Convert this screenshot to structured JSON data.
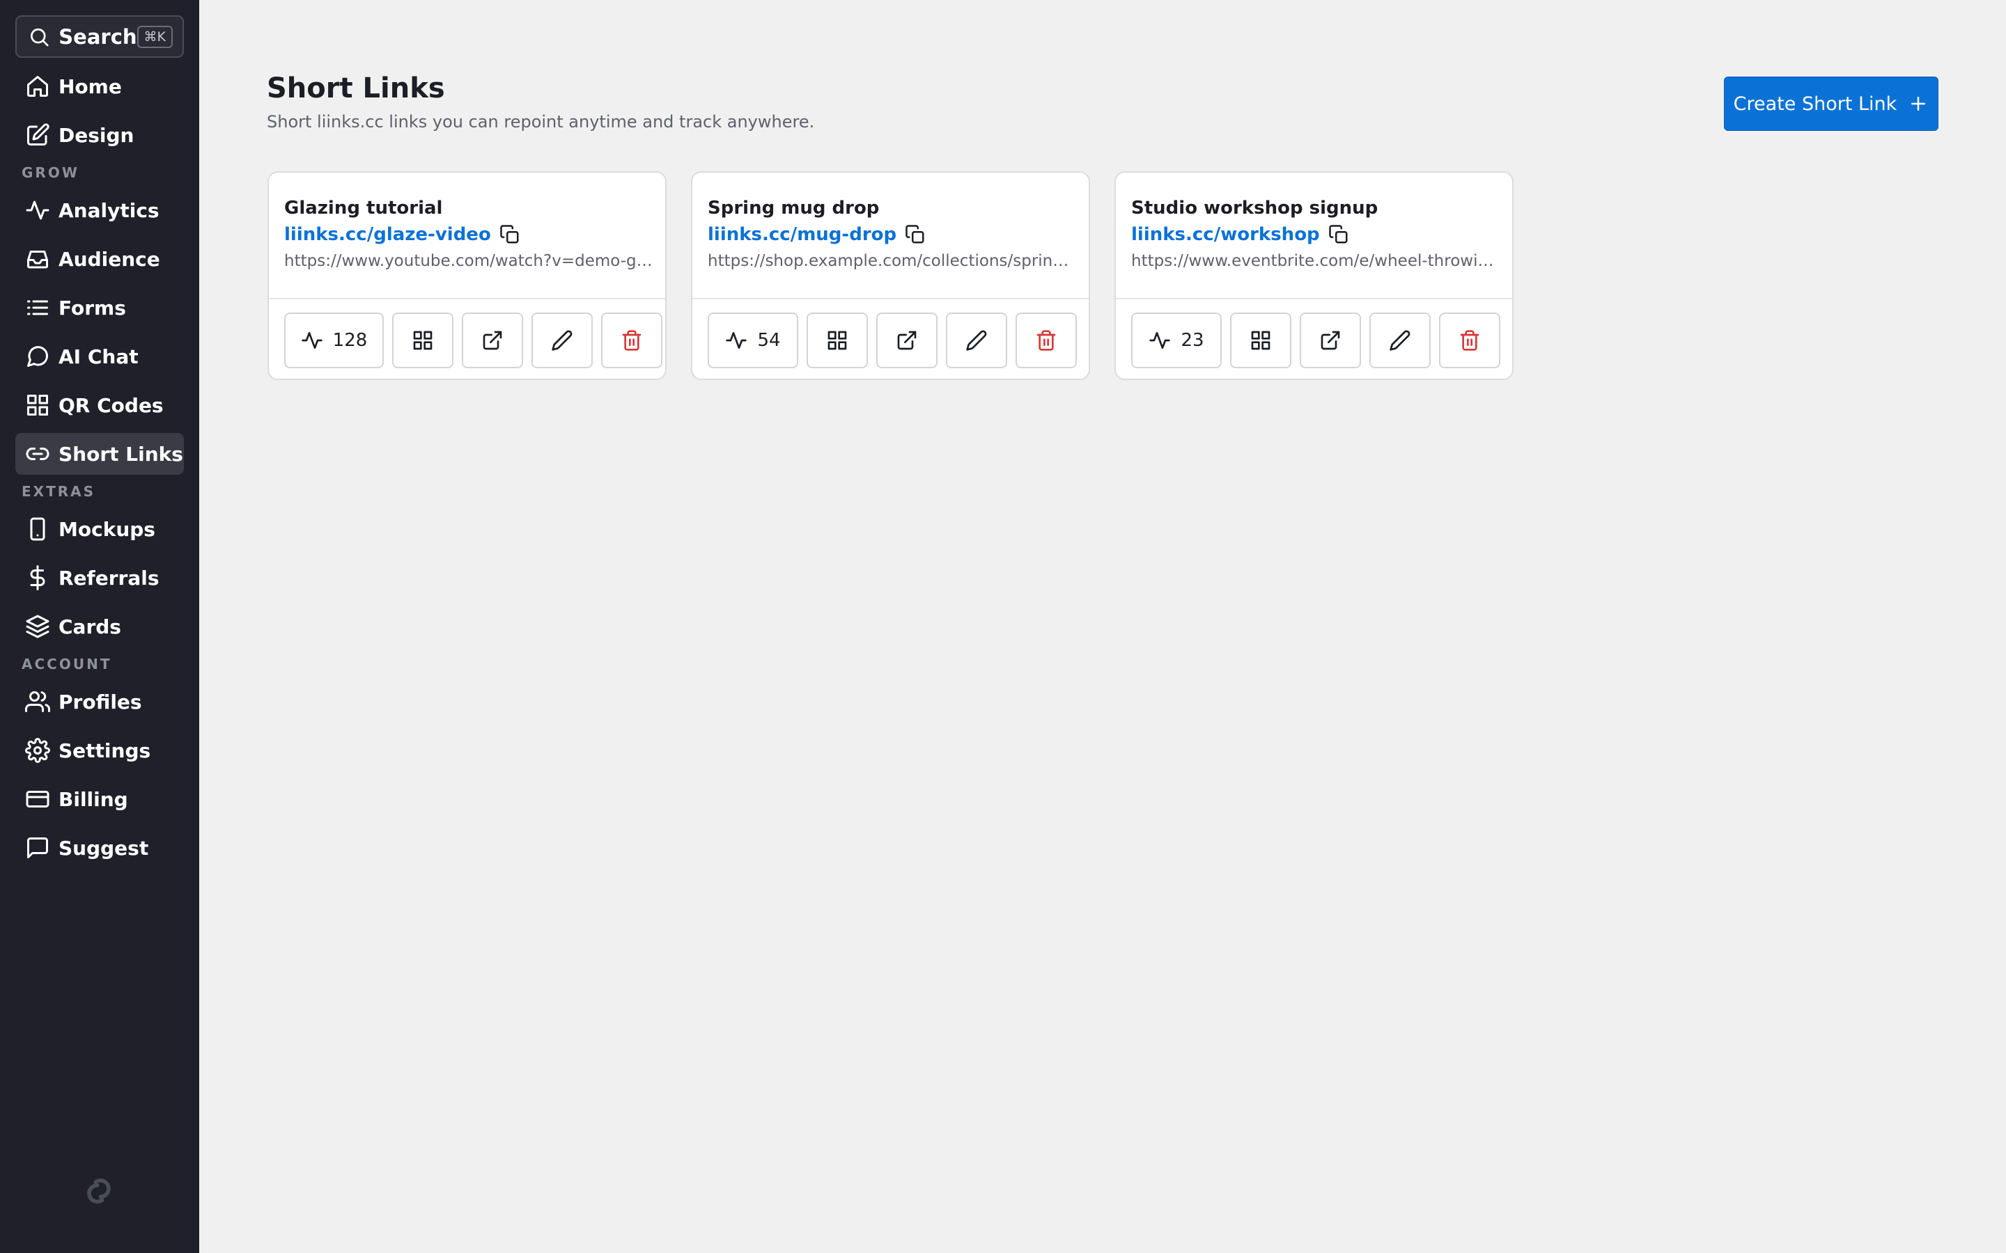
{
  "sidebar": {
    "search": {
      "label": "Search",
      "shortcut": "⌘K",
      "icon": "search-icon"
    },
    "items_top": [
      {
        "label": "Home",
        "icon": "home-icon"
      },
      {
        "label": "Design",
        "icon": "edit-icon"
      }
    ],
    "sections": [
      {
        "label": "GROW",
        "items": [
          {
            "label": "Analytics",
            "icon": "activity-icon"
          },
          {
            "label": "Audience",
            "icon": "inbox-icon"
          },
          {
            "label": "Forms",
            "icon": "list-icon"
          },
          {
            "label": "AI Chat",
            "icon": "chat-bubble-icon"
          },
          {
            "label": "QR Codes",
            "icon": "grid-icon"
          },
          {
            "label": "Short Links",
            "icon": "link-icon",
            "active": true
          }
        ]
      },
      {
        "label": "EXTRAS",
        "items": [
          {
            "label": "Mockups",
            "icon": "phone-icon"
          },
          {
            "label": "Referrals",
            "icon": "dollar-icon"
          },
          {
            "label": "Cards",
            "icon": "layers-icon"
          }
        ]
      },
      {
        "label": "ACCOUNT",
        "items": [
          {
            "label": "Profiles",
            "icon": "users-icon"
          },
          {
            "label": "Settings",
            "icon": "gear-icon"
          },
          {
            "label": "Billing",
            "icon": "credit-card-icon"
          },
          {
            "label": "Suggest",
            "icon": "message-square-icon"
          }
        ]
      }
    ]
  },
  "header": {
    "title": "Short Links",
    "subtitle": "Short liinks.cc links you can repoint anytime and track anywhere.",
    "create_label": "Create Short Link"
  },
  "links": [
    {
      "title": "Glazing tutorial",
      "short_url": "liinks.cc/glaze-video",
      "target": "https://www.youtube.com/watch?v=demo-glaze-video",
      "clicks": "128"
    },
    {
      "title": "Spring mug drop",
      "short_url": "liinks.cc/mug-drop",
      "target": "https://shop.example.com/collections/spring-mugs",
      "clicks": "54"
    },
    {
      "title": "Studio workshop signup",
      "short_url": "liinks.cc/workshop",
      "target": "https://www.eventbrite.com/e/wheel-throwing-workshop",
      "clicks": "23"
    }
  ],
  "colors": {
    "sidebar_bg": "#1f2029",
    "page_bg": "#f0f0f0",
    "accent": "#0a72d6",
    "danger": "#d93838"
  }
}
